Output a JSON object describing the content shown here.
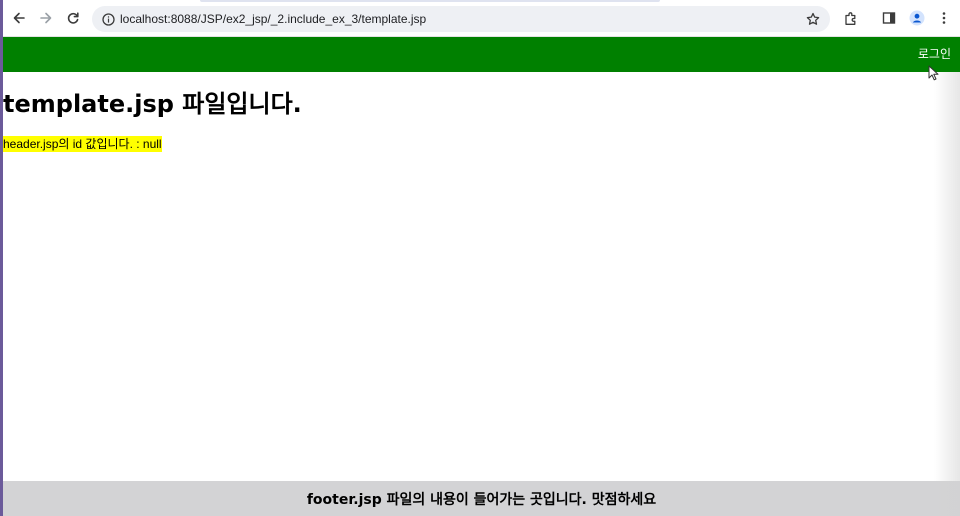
{
  "browser": {
    "url": "localhost:8088/JSP/ex2_jsp/_2.include_ex_3/template.jsp",
    "icons": {
      "back": "arrow-left-icon",
      "forward": "arrow-right-icon",
      "reload": "reload-icon",
      "site_info": "info-icon",
      "bookmark": "star-icon",
      "extensions": "puzzle-icon",
      "side_panel": "side-panel-icon",
      "profile": "profile-icon",
      "menu": "more-vert-icon"
    }
  },
  "header": {
    "background_color": "#008000",
    "login_label": "로그인"
  },
  "main": {
    "title": "template.jsp 파일입니다.",
    "id_line": "header.jsp의 id 값입니다. : null",
    "id_highlight_color": "#ffff00"
  },
  "footer": {
    "text": "footer.jsp 파일의 내용이 들어가는 곳입니다. 맛점하세요",
    "background_color": "#d3d3d5"
  }
}
